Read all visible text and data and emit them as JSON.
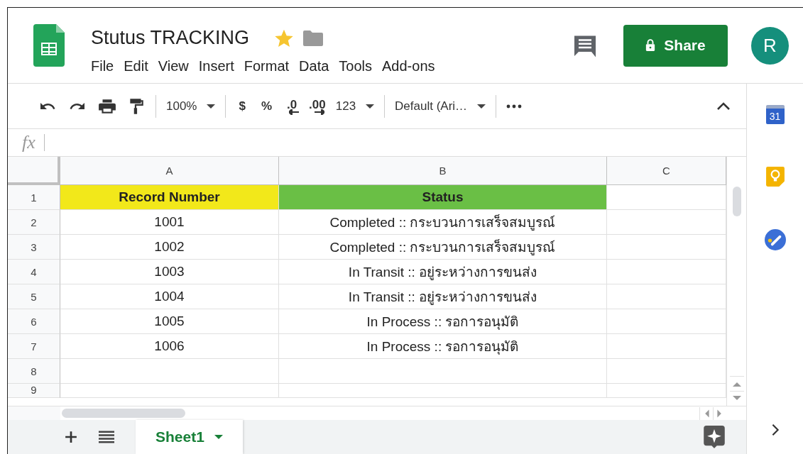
{
  "document": {
    "title": "Stutus TRACKING",
    "starred": true
  },
  "menu": [
    "File",
    "Edit",
    "View",
    "Insert",
    "Format",
    "Data",
    "Tools",
    "Add-ons"
  ],
  "share_button": {
    "label": "Share"
  },
  "avatar": {
    "initial": "R"
  },
  "toolbar": {
    "zoom": "100%",
    "currency": "$",
    "percent": "%",
    "decrease_decimals": ".0",
    "increase_decimals": ".00",
    "number_format": "123",
    "font": "Default (Ari…"
  },
  "formula_bar": {
    "label": "fx"
  },
  "columns": [
    "A",
    "B",
    "C"
  ],
  "rows": [
    {
      "number": "1",
      "kind": "header",
      "cells": [
        {
          "text": "Record Number",
          "color": "#f2e81a"
        },
        {
          "text": "Status",
          "color": "#6abf45"
        }
      ]
    },
    {
      "number": "2",
      "kind": "data",
      "cells": [
        {
          "text": "1001"
        },
        {
          "text": "Completed :: กระบวนการเสร็จสมบูรณ์"
        }
      ]
    },
    {
      "number": "3",
      "kind": "data",
      "cells": [
        {
          "text": "1002"
        },
        {
          "text": "Completed :: กระบวนการเสร็จสมบูรณ์"
        }
      ]
    },
    {
      "number": "4",
      "kind": "data",
      "cells": [
        {
          "text": "1003"
        },
        {
          "text": "In Transit :: อยู่ระหว่างการขนส่ง"
        }
      ]
    },
    {
      "number": "5",
      "kind": "data",
      "cells": [
        {
          "text": "1004"
        },
        {
          "text": "In Transit :: อยู่ระหว่างการขนส่ง"
        }
      ]
    },
    {
      "number": "6",
      "kind": "data",
      "cells": [
        {
          "text": "1005"
        },
        {
          "text": "In Process :: รอการอนุมัติ"
        }
      ]
    },
    {
      "number": "7",
      "kind": "data",
      "cells": [
        {
          "text": "1006"
        },
        {
          "text": "In Process :: รอการอนุมัติ"
        }
      ]
    },
    {
      "number": "8"
    },
    {
      "number": "9"
    }
  ],
  "sheet_tabs": [
    {
      "label": "Sheet1",
      "selected": true
    }
  ],
  "side_panel": {
    "calendar_day": "31"
  }
}
